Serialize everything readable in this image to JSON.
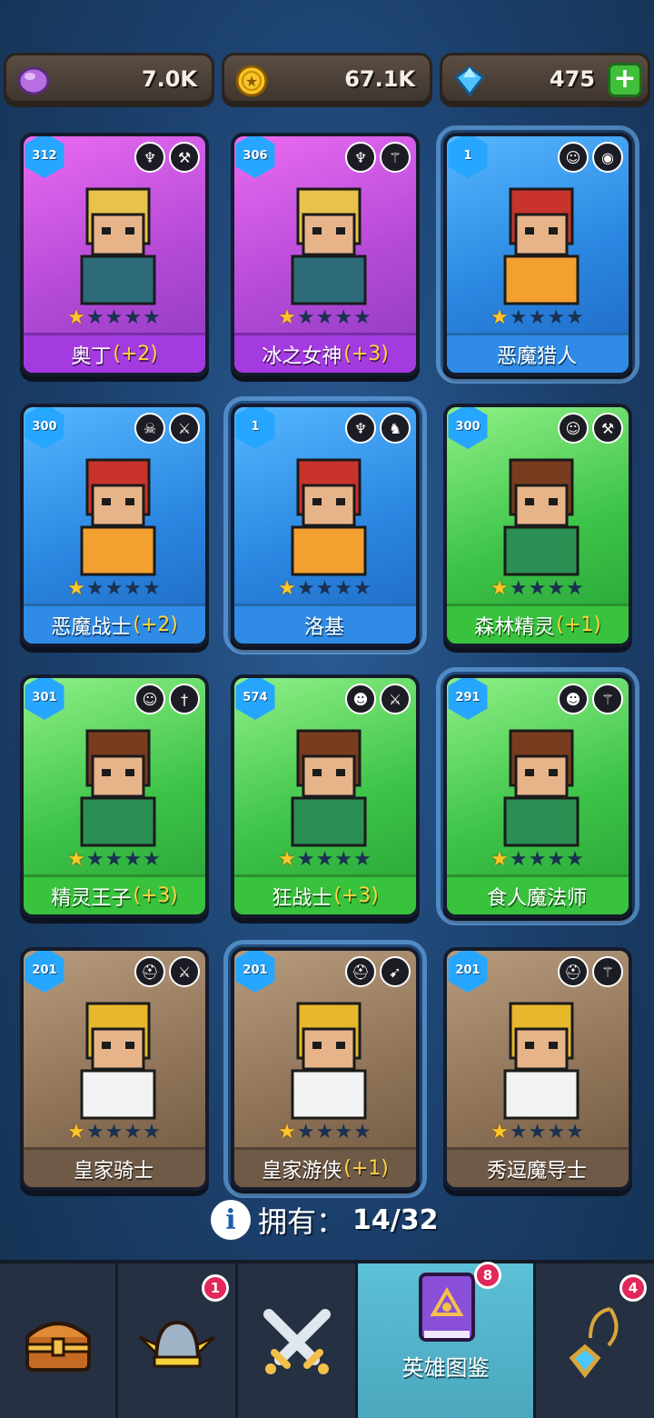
{
  "resources": {
    "elixir": {
      "icon": "purple-gem-icon",
      "value": "7.0K"
    },
    "gold": {
      "icon": "gold-coin-icon",
      "value": "67.1K"
    },
    "diamond": {
      "icon": "blue-diamond-icon",
      "value": "475",
      "add_label": "+"
    }
  },
  "heroes": [
    {
      "level": "312",
      "name": "奥丁",
      "bonus": "(+2)",
      "rarity": "purple",
      "stars": 1,
      "badges": [
        "winged-emblem-icon",
        "hammer-icon"
      ]
    },
    {
      "level": "306",
      "name": "冰之女神",
      "bonus": "(+3)",
      "rarity": "purple",
      "stars": 1,
      "badges": [
        "winged-emblem-icon",
        "staff-icon"
      ]
    },
    {
      "level": "1",
      "name": "恶魔猎人",
      "bonus": "",
      "rarity": "blue",
      "stars": 1,
      "badges": [
        "elf-face-icon",
        "eye-icon"
      ]
    },
    {
      "level": "300",
      "name": "恶魔战士",
      "bonus": "(+2)",
      "rarity": "blue",
      "stars": 1,
      "badges": [
        "demon-skull-icon",
        "sword-icon"
      ]
    },
    {
      "level": "1",
      "name": "洛基",
      "bonus": "",
      "rarity": "blue",
      "stars": 1,
      "badges": [
        "winged-emblem-icon",
        "dragon-icon"
      ]
    },
    {
      "level": "300",
      "name": "森林精灵",
      "bonus": "(+1)",
      "rarity": "green",
      "stars": 1,
      "badges": [
        "elf-face-icon",
        "hammer-icon"
      ]
    },
    {
      "level": "301",
      "name": "精灵王子",
      "bonus": "(+3)",
      "rarity": "green",
      "stars": 1,
      "badges": [
        "elf-face-icon",
        "dagger-icon"
      ]
    },
    {
      "level": "574",
      "name": "狂战士",
      "bonus": "(+3)",
      "rarity": "green",
      "stars": 1,
      "badges": [
        "orc-face-icon",
        "sword-icon"
      ]
    },
    {
      "level": "291",
      "name": "食人魔法师",
      "bonus": "",
      "rarity": "green",
      "stars": 1,
      "badges": [
        "orc-face-icon",
        "staff-icon"
      ]
    },
    {
      "level": "201",
      "name": "皇家骑士",
      "bonus": "",
      "rarity": "brown",
      "stars": 1,
      "badges": [
        "helmet-icon",
        "sword-icon"
      ]
    },
    {
      "level": "201",
      "name": "皇家游侠",
      "bonus": "(+1)",
      "rarity": "brown",
      "stars": 1,
      "badges": [
        "helmet-icon",
        "bow-icon"
      ]
    },
    {
      "level": "201",
      "name": "秀逗魔导士",
      "bonus": "",
      "rarity": "brown",
      "stars": 1,
      "badges": [
        "helmet-icon",
        "staff-icon"
      ]
    }
  ],
  "owned": {
    "label": "拥有：",
    "count": "14/32"
  },
  "nav": {
    "tabs": [
      {
        "icon": "treasure-chest-icon",
        "label": "",
        "badge": ""
      },
      {
        "icon": "winged-helmet-icon",
        "label": "",
        "badge": "1"
      },
      {
        "icon": "crossed-swords-icon",
        "label": "",
        "badge": ""
      },
      {
        "icon": "hero-book-icon",
        "label": "英雄图鉴",
        "badge": "8"
      },
      {
        "icon": "amulet-icon",
        "label": "",
        "badge": "4"
      }
    ]
  },
  "colors": {
    "purple": "#b54ad8",
    "blue": "#2a86e0",
    "green": "#3dc348",
    "brown": "#8f7459",
    "accent": "#ffd23a"
  }
}
